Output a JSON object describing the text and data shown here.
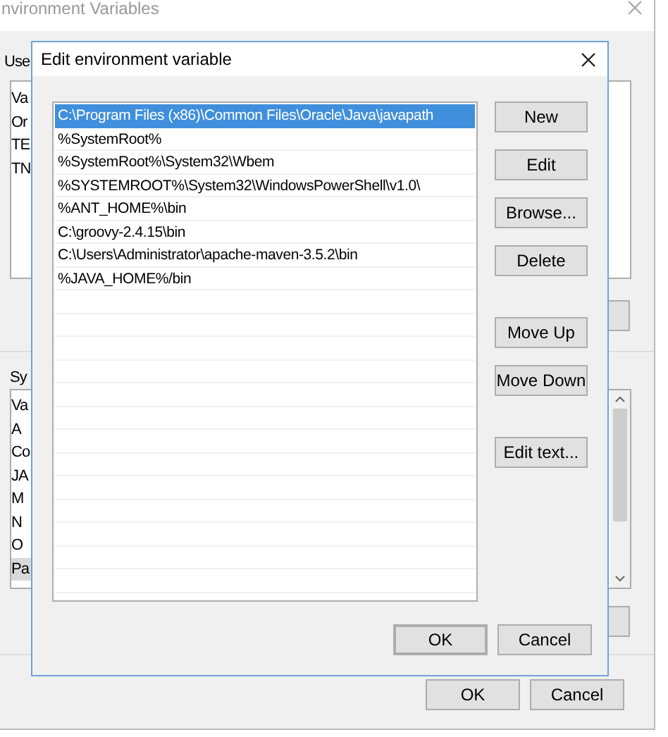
{
  "background_window": {
    "title": "nvironment Variables",
    "user_section": {
      "label": "Use",
      "header": "Va",
      "rows": [
        "Or",
        "TE",
        "TN"
      ]
    },
    "system_section": {
      "label": "Sy",
      "header": "Va",
      "rows": [
        {
          "text": "A",
          "selected": false
        },
        {
          "text": "Co",
          "selected": false
        },
        {
          "text": "JA",
          "selected": false
        },
        {
          "text": "M",
          "selected": false
        },
        {
          "text": "N",
          "selected": false
        },
        {
          "text": "O",
          "selected": false
        },
        {
          "text": "Pa",
          "selected": true
        }
      ]
    },
    "buttons": [
      "OK",
      "Cancel"
    ]
  },
  "dialog": {
    "title": "Edit environment variable",
    "entries": [
      {
        "text": "C:\\Program Files (x86)\\Common Files\\Oracle\\Java\\javapath",
        "selected": true
      },
      {
        "text": "%SystemRoot%",
        "selected": false
      },
      {
        "text": "%SystemRoot%\\System32\\Wbem",
        "selected": false
      },
      {
        "text": "%SYSTEMROOT%\\System32\\WindowsPowerShell\\v1.0\\",
        "selected": false
      },
      {
        "text": "%ANT_HOME%\\bin",
        "selected": false
      },
      {
        "text": "C:\\groovy-2.4.15\\bin",
        "selected": false
      },
      {
        "text": "C:\\Users\\Administrator\\apache-maven-3.5.2\\bin",
        "selected": false
      },
      {
        "text": "%JAVA_HOME%/bin",
        "selected": false
      }
    ],
    "side_button_groups": [
      [
        "New",
        "Edit",
        "Browse...",
        "Delete"
      ],
      [
        "Move Up",
        "Move Down"
      ],
      [
        "Edit text..."
      ]
    ],
    "ok": "OK",
    "cancel": "Cancel"
  }
}
